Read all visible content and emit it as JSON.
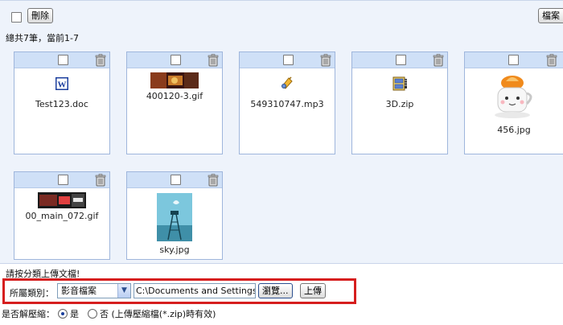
{
  "toolbar": {
    "delete_label": "刪除",
    "files_label": "檔案"
  },
  "summary": "總共7筆，當前1-7",
  "files": [
    {
      "name": "Test123.doc",
      "icon": "word-doc-icon"
    },
    {
      "name": "400120-3.gif",
      "icon": "image-thumbnail"
    },
    {
      "name": "549310747.mp3",
      "icon": "audio-file-icon"
    },
    {
      "name": "3D.zip",
      "icon": "zip-archive-icon"
    },
    {
      "name": "456.jpg",
      "icon": "coffee-cup-image"
    },
    {
      "name": "00_main_072.gif",
      "icon": "banner-image"
    },
    {
      "name": "sky.jpg",
      "icon": "sky-tower-image"
    }
  ],
  "upload": {
    "hint": "請按分類上傳文檔!",
    "category_label": "所屬類別：",
    "category_value": "影音檔案",
    "path_value": "C:\\Documents and Settings",
    "browse_label": "瀏覽...",
    "upload_label": "上傳"
  },
  "unzip": {
    "label": "是否解壓縮：",
    "yes": "是",
    "no": "否",
    "note": "(上傳壓縮檔(*.zip)時有效)"
  },
  "colors": {
    "highlight_border": "#d61e1e",
    "card_header": "#cfe0f7",
    "panel_bg": "#eef3fb"
  }
}
